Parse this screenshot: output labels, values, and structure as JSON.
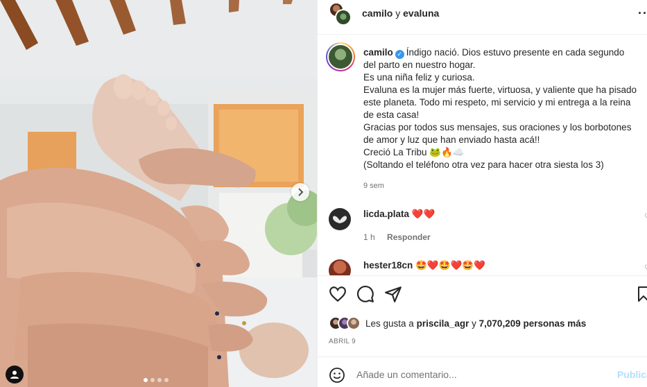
{
  "post": {
    "header": {
      "author": "camilo",
      "connector": "y",
      "coauthor": "evaluna",
      "more_icon": "more-horizontal-icon"
    },
    "media": {
      "carousel_dots": 4,
      "active_dot": 1,
      "next_icon": "chevron-right-icon",
      "tag_icon": "user-tag-icon"
    },
    "caption": {
      "username": "camilo",
      "verified": true,
      "lines": [
        "Índigo nació. Dios estuvo presente en cada segundo",
        "del parto en nuestro hogar.",
        "Es una niña feliz y curiosa.",
        "Evaluna es la mujer más fuerte, virtuosa, y valiente que ha pisado",
        "este planeta. Todo mi respeto, mi servicio y mi entrega a la reina",
        "de esta casa!",
        "Gracias por todos sus mensajes, sus oraciones y los borbotones",
        "de amor y luz que han enviado hasta acá!!",
        "Creció La Tribu 🐸🔥☁️",
        "(Soltando el teléfono otra vez para hacer otra siesta los 3)"
      ],
      "time": "9 sem"
    },
    "comments": [
      {
        "username": "licda.plata",
        "text": "❤️❤️",
        "time": "1 h",
        "reply_label": "Responder"
      },
      {
        "username": "hester18cn",
        "text": "🤩❤️🤩❤️🤩❤️"
      }
    ],
    "actions": {
      "like_icon": "heart-icon",
      "comment_icon": "comment-icon",
      "share_icon": "send-icon",
      "save_icon": "bookmark-icon"
    },
    "likes": {
      "prefix": "Les gusta a",
      "user": "priscila_agr",
      "connector": "y",
      "others": "7,070,209 personas más"
    },
    "date": "ABRIL 9",
    "comment_box": {
      "placeholder": "Añade un comentario...",
      "publish_label": "Publicar",
      "emoji_icon": "emoji-icon"
    }
  }
}
